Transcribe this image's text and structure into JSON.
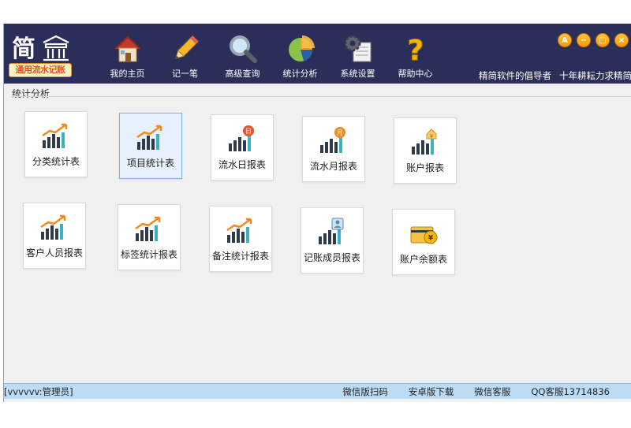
{
  "app": {
    "logo_glyph_1": "简",
    "logo_glyph_2": "",
    "logo_text": "通用流水记账",
    "slogan_1": "精简软件的倡导者",
    "slogan_2": "十年耕耘力求精简"
  },
  "nav": [
    {
      "label": "我的主页",
      "icon": "home-icon"
    },
    {
      "label": "记一笔",
      "icon": "pencil-icon"
    },
    {
      "label": "高级查询",
      "icon": "magnifier-icon"
    },
    {
      "label": "统计分析",
      "icon": "pie-chart-icon"
    },
    {
      "label": "系统设置",
      "icon": "gear-icon"
    },
    {
      "label": "帮助中心",
      "icon": "question-icon"
    }
  ],
  "window_controls": {
    "font": "A",
    "minimize": "−",
    "maximize": "□",
    "close": "×"
  },
  "section_title": "统计分析",
  "tiles": [
    {
      "label": "分类统计表",
      "icon": "bar-chart-icon"
    },
    {
      "label": "项目统计表",
      "icon": "bar-chart-icon"
    },
    {
      "label": "流水日报表",
      "icon": "daily-chart-icon",
      "badge": "日"
    },
    {
      "label": "流水月报表",
      "icon": "monthly-chart-icon",
      "badge": "月"
    },
    {
      "label": "账户报表",
      "icon": "account-chart-icon",
      "badge": "¥"
    },
    {
      "label": "客户人员报表",
      "icon": "bar-chart-icon"
    },
    {
      "label": "标签统计报表",
      "icon": "bar-chart-icon"
    },
    {
      "label": "备注统计报表",
      "icon": "bar-chart-icon"
    },
    {
      "label": "记账成员报表",
      "icon": "member-chart-icon"
    },
    {
      "label": "账户余额表",
      "icon": "wallet-icon"
    }
  ],
  "status": {
    "user": "[vvvvvv:管理员]",
    "links": [
      "微信版扫码",
      "安卓版下载",
      "微信客服",
      "QQ客服13714836"
    ]
  },
  "colors": {
    "topbar": "#2a2e58",
    "accent": "#f39a0a",
    "statusbar": "#bcdcf5",
    "chart_bar": "#2f3a4a",
    "chart_teal": "#3bb3c3",
    "chart_arrow": "#f08a1c"
  }
}
